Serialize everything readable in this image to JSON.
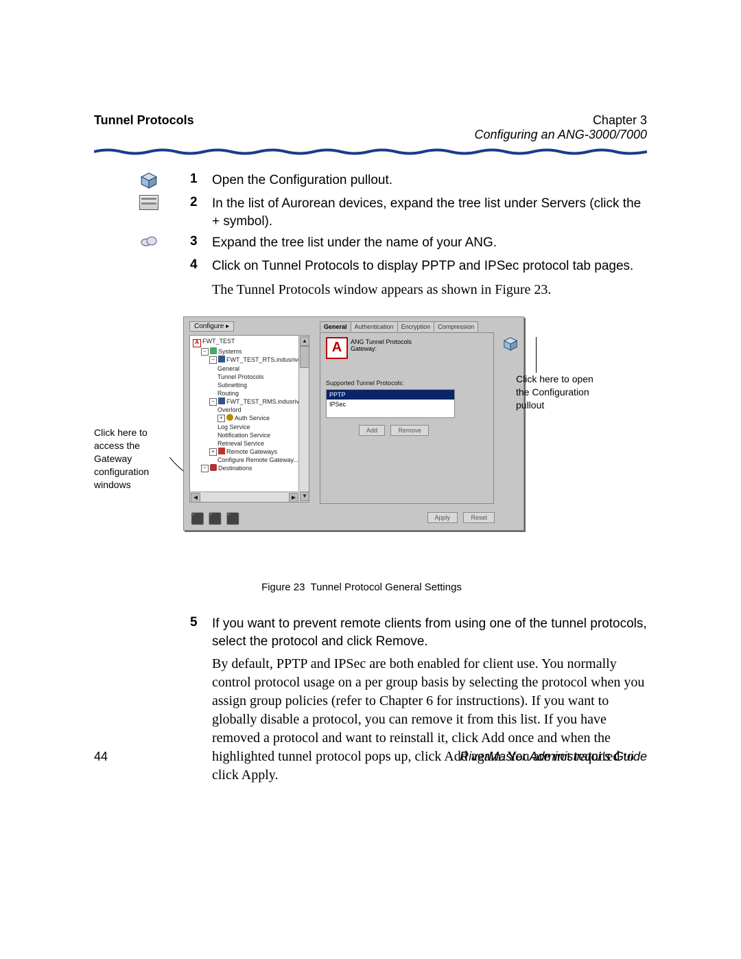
{
  "header": {
    "left": "Tunnel Protocols",
    "right_top": "Chapter 3",
    "right_bottom": "Configuring an ANG-3000/7000"
  },
  "steps": [
    {
      "n": "1",
      "text": "Open the Configuration pullout."
    },
    {
      "n": "2",
      "text": "In the list of Aurorean devices, expand the tree list under Servers (click the + symbol)."
    },
    {
      "n": "3",
      "text": "Expand the tree list under the name of your ANG."
    },
    {
      "n": "4",
      "text": "Click on Tunnel Protocols to display PPTP and IPSec protocol tab pages."
    }
  ],
  "after_step4": "The Tunnel Protocols window appears as shown in Figure 23.",
  "callouts": {
    "left": "Click here to access the Gateway configuration windows",
    "right": "Click here to open the Configuration pullout"
  },
  "window": {
    "configure_btn": "Configure ▸",
    "tree": {
      "root": "FWT_TEST",
      "systems": "Systems",
      "host1": "FWT_TEST_RTS.indusriver.co",
      "general": "General",
      "tunnel_protocols": "Tunnel Protocols",
      "subnetting": "Subnetting",
      "routing": "Routing",
      "host2": "FWT_TEST_RMS.indusriver.co",
      "overlord": "Overlord",
      "auth": "Auth Service",
      "log": "Log Service",
      "notif": "Notification Service",
      "retrieval": "Retrieval Service",
      "remote_gw": "Remote Gateways",
      "cfg_remote": "Configure Remote Gateway...",
      "dest": "Destinations"
    },
    "tabs": {
      "general": "General",
      "auth": "Authentication",
      "encryption": "Encryption",
      "compression": "Compression"
    },
    "panel": {
      "title1": "ANG Tunnel Protocols",
      "title2": "Gateway:",
      "supported": "Supported Tunnel Protocols:",
      "proto1": "PPTP",
      "proto2": "IPSec",
      "add": "Add",
      "remove": "Remove"
    },
    "bottom": {
      "apply": "Apply",
      "reset": "Reset"
    }
  },
  "figure": {
    "label": "Figure 23",
    "caption": "Tunnel Protocol General Settings"
  },
  "step5": {
    "n": "5",
    "text": "If you want to prevent remote clients from using one of the tunnel protocols, select the protocol and click Remove.",
    "para": "By default, PPTP and IPSec are both enabled for client use. You normally control protocol usage on a per group basis by selecting the protocol when you assign group policies (refer to Chapter 6 for instructions). If you want to globally disable a protocol, you can remove it from this list. If you have removed a protocol and want to reinstall it, click Add once and when the highlighted tunnel protocol pops up, click Add again. You are not required to click Apply."
  },
  "footer": {
    "page": "44",
    "guide": "RiverMaster Administrator's Guide"
  }
}
